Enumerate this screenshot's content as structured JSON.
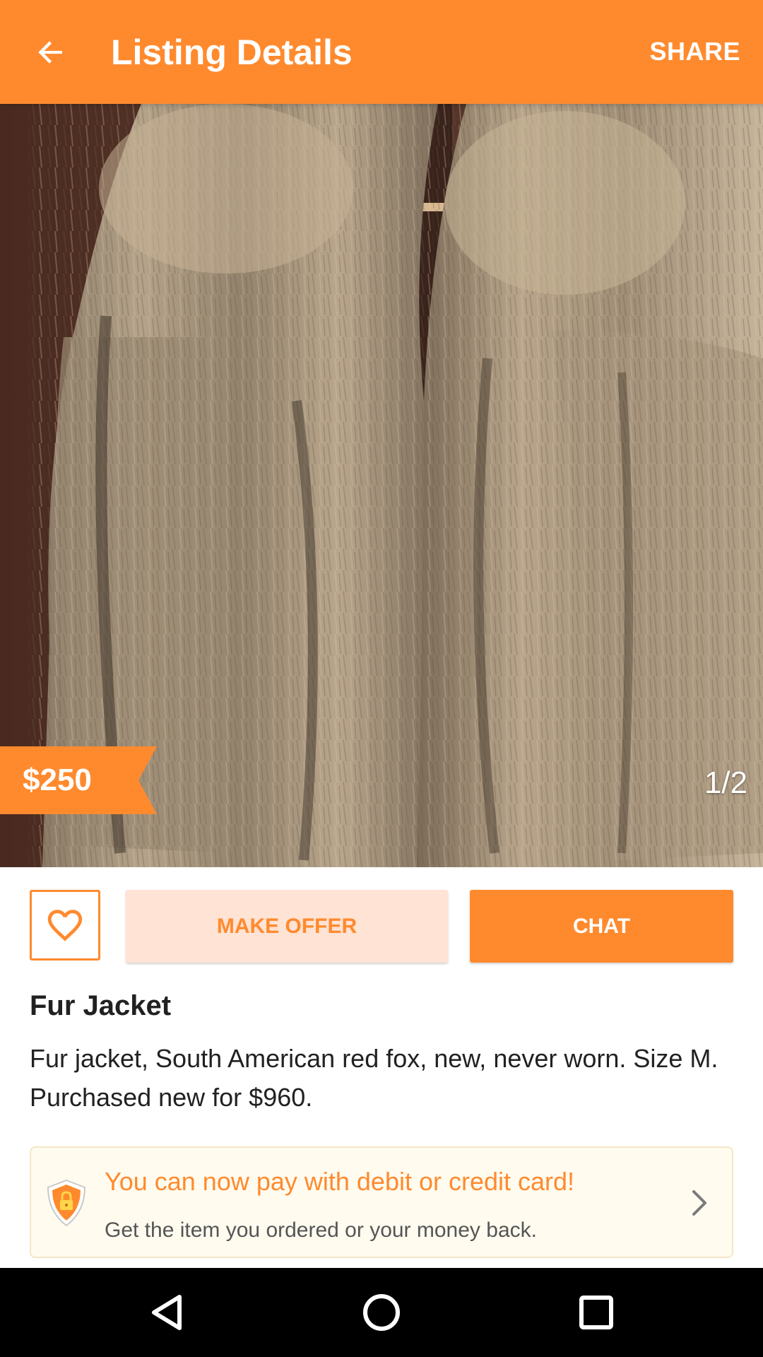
{
  "appbar": {
    "title": "Listing Details",
    "share_label": "SHARE",
    "back_icon": "arrow-left-icon",
    "color": "#ff8a2e"
  },
  "photo": {
    "price": "$250",
    "counter": "1/2"
  },
  "actions": {
    "favorite_icon": "heart-outline-icon",
    "make_offer_label": "MAKE OFFER",
    "chat_label": "CHAT"
  },
  "listing": {
    "title": "Fur Jacket",
    "description": "Fur jacket, South American red fox, new, never worn. Size M. Purchased new for $960."
  },
  "promo": {
    "icon": "shield-lock-icon",
    "headline": "You can now pay with debit or credit card!",
    "subtext": "Get the item you ordered or your money back.",
    "chevron_icon": "chevron-right-icon"
  },
  "navbar": {
    "back_icon": "nav-back-icon",
    "home_icon": "nav-home-icon",
    "recents_icon": "nav-recents-icon"
  }
}
